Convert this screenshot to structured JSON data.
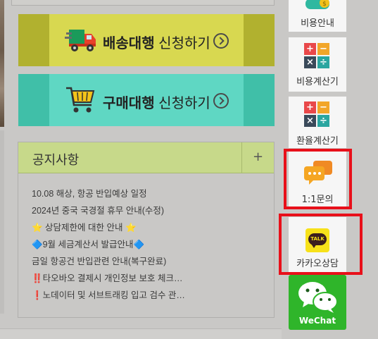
{
  "banners": {
    "delivery": {
      "bold": "배송대행",
      "rest": " 신청하기"
    },
    "purchase": {
      "bold": "구매대행",
      "rest": " 신청하기"
    }
  },
  "notice": {
    "title": "공지사항",
    "more": "+",
    "items": [
      "10.08 해상, 항공 반입예상 일정",
      "2024년 중국 국경절 휴무 안내(수정)",
      "⭐ 상담제한에 대한 안내 ⭐",
      "🔷9월 세금계산서 발급안내🔷",
      "금일 항공건 반입관련 안내(복구완료)",
      "‼️타오바오 결제시 개인정보 보호 체크…",
      "❗노데이터 및 서브트래킹 입고 검수 관…"
    ]
  },
  "sidebar": {
    "fee_guide": "비용안내",
    "fee_calc": "비용계산기",
    "fx_calc": "환율계산기",
    "inquiry": "1:1문의",
    "kakao": "카카오상담",
    "kakao_badge": "TALK",
    "wechat": "WeChat"
  },
  "calc_symbols": [
    "+",
    "−",
    "×",
    "÷"
  ],
  "colors": {
    "delivery_accent": "#d8d850",
    "purchase_accent": "#5fd7c3",
    "notice_header": "#c7d98a",
    "highlight": "#e8101a",
    "kakao_yellow": "#f7e11a",
    "wechat_green": "#2fb52a"
  }
}
